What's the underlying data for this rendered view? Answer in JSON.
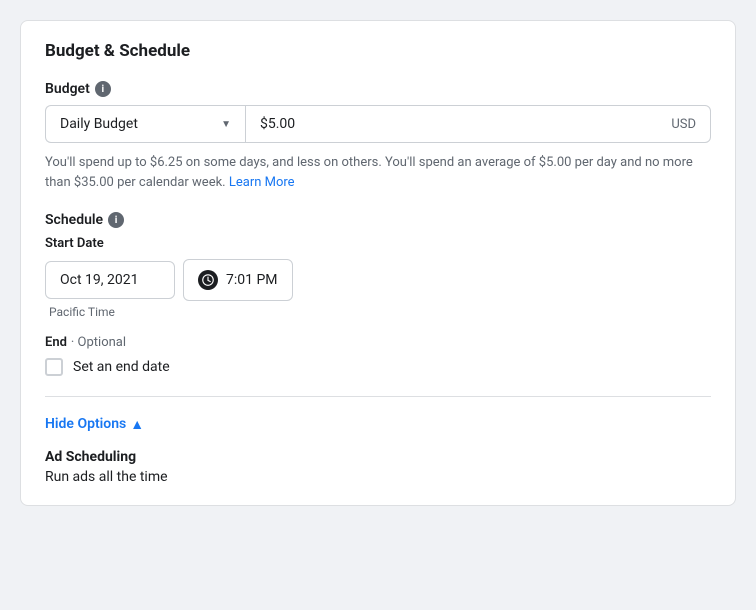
{
  "card": {
    "section_title": "Budget & Schedule",
    "budget": {
      "label": "Budget",
      "info_icon": "i",
      "type_value": "Daily Budget",
      "amount_value": "$5.00",
      "currency": "USD",
      "hint_text": "You'll spend up to $6.25 on some days, and less on others. You'll spend an average of $5.00 per day and no more than $35.00 per calendar week.",
      "hint_link_text": "Learn More"
    },
    "schedule": {
      "label": "Schedule",
      "info_icon": "i",
      "start_date": {
        "label": "Start Date",
        "date_value": "Oct 19, 2021",
        "time_value": "7:01 PM",
        "timezone": "Pacific Time"
      },
      "end": {
        "label": "End",
        "optional_label": "· Optional",
        "checkbox_label": "Set an end date"
      }
    },
    "hide_options": {
      "link_text": "Hide Options",
      "arrow": "▲"
    },
    "ad_scheduling": {
      "title": "Ad Scheduling",
      "value": "Run ads all the time"
    }
  }
}
